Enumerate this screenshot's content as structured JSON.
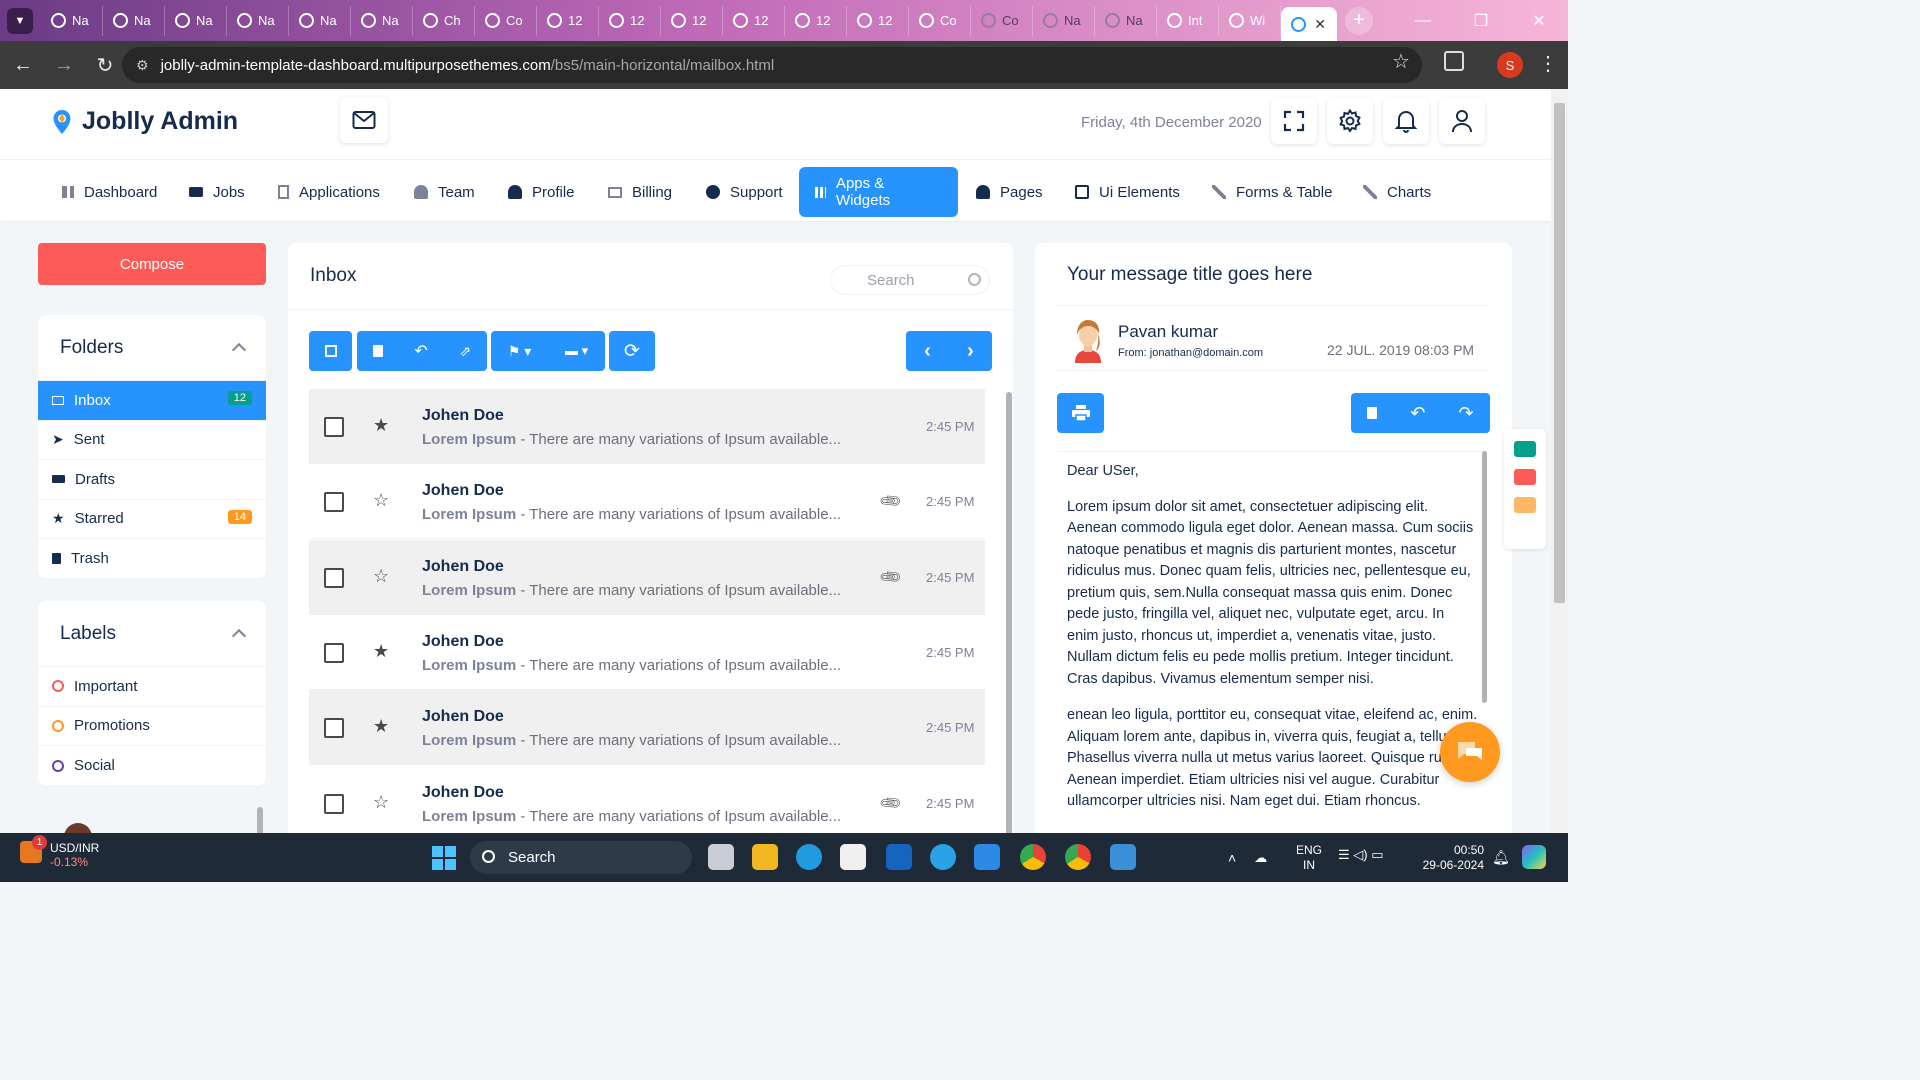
{
  "browser": {
    "tabs": [
      {
        "label": "Na"
      },
      {
        "label": "Na"
      },
      {
        "label": "Na"
      },
      {
        "label": "Na"
      },
      {
        "label": "Na"
      },
      {
        "label": "Na"
      },
      {
        "label": "Ch"
      },
      {
        "label": "Co"
      },
      {
        "label": "12"
      },
      {
        "label": "12"
      },
      {
        "label": "12"
      },
      {
        "label": "12"
      },
      {
        "label": "12"
      },
      {
        "label": "12"
      },
      {
        "label": "Co"
      },
      {
        "label": "Co"
      },
      {
        "label": "Na"
      },
      {
        "label": "Na"
      },
      {
        "label": "Int"
      },
      {
        "label": "Wi"
      }
    ],
    "url_site": "joblly-admin-template-dashboard.multipurposethemes.com",
    "url_path": "/bs5/main-horizontal/mailbox.html",
    "profile_initial": "S"
  },
  "header": {
    "logo_text": "Joblly Admin",
    "date": "Friday, 4th December 2020"
  },
  "nav": {
    "items": [
      {
        "label": "Dashboard"
      },
      {
        "label": "Jobs"
      },
      {
        "label": "Applications"
      },
      {
        "label": "Team"
      },
      {
        "label": "Profile"
      },
      {
        "label": "Billing"
      },
      {
        "label": "Support"
      },
      {
        "label": "Apps & Widgets"
      },
      {
        "label": "Pages"
      },
      {
        "label": "Ui Elements"
      },
      {
        "label": "Forms & Table"
      },
      {
        "label": "Charts"
      }
    ]
  },
  "sidebar": {
    "compose_label": "Compose",
    "folders_title": "Folders",
    "folders": [
      {
        "label": "Inbox",
        "badge": "12"
      },
      {
        "label": "Sent",
        "badge": ""
      },
      {
        "label": "Drafts",
        "badge": ""
      },
      {
        "label": "Starred",
        "badge": "14"
      },
      {
        "label": "Trash",
        "badge": ""
      }
    ],
    "labels_title": "Labels",
    "labels": [
      {
        "label": "Important",
        "color": "#fc5b58"
      },
      {
        "label": "Promotions",
        "color": "#ff9920"
      },
      {
        "label": "Social",
        "color": "#6b3fa0"
      }
    ]
  },
  "inbox": {
    "title": "Inbox",
    "search_placeholder": "Search",
    "mails": [
      {
        "sender": "Johen Doe",
        "subject": "Lorem Ipsum",
        "snippet": " - There are many variations of Ipsum available...",
        "time": "2:45 PM",
        "starred": true,
        "attachment": false
      },
      {
        "sender": "Johen Doe",
        "subject": "Lorem Ipsum",
        "snippet": " - There are many variations of Ipsum available...",
        "time": "2:45 PM",
        "starred": false,
        "attachment": true
      },
      {
        "sender": "Johen Doe",
        "subject": "Lorem Ipsum",
        "snippet": " - There are many variations of Ipsum available...",
        "time": "2:45 PM",
        "starred": false,
        "attachment": true
      },
      {
        "sender": "Johen Doe",
        "subject": "Lorem Ipsum",
        "snippet": " - There are many variations of Ipsum available...",
        "time": "2:45 PM",
        "starred": true,
        "attachment": false
      },
      {
        "sender": "Johen Doe",
        "subject": "Lorem Ipsum",
        "snippet": " - There are many variations of Ipsum available...",
        "time": "2:45 PM",
        "starred": true,
        "attachment": false
      },
      {
        "sender": "Johen Doe",
        "subject": "Lorem Ipsum",
        "snippet": " - There are many variations of Ipsum available...",
        "time": "2:45 PM",
        "starred": false,
        "attachment": true
      }
    ]
  },
  "reader": {
    "title": "Your message title goes here",
    "from_name": "Pavan kumar",
    "from_email": "From: jonathan@domain.com",
    "date": "22 JUL. 2019 08:03 PM",
    "greeting": "Dear USer,",
    "para1": "Lorem ipsum dolor sit amet, consectetuer adipiscing elit. Aenean commodo ligula eget dolor. Aenean massa. Cum sociis natoque penatibus et magnis dis parturient montes, nascetur ridiculus mus. Donec quam felis, ultricies nec, pellentesque eu, pretium quis, sem.Nulla consequat massa quis enim. Donec pede justo, fringilla vel, aliquet nec, vulputate eget, arcu. In enim justo, rhoncus ut, imperdiet a, venenatis vitae, justo. Nullam dictum felis eu pede mollis pretium. Integer tincidunt. Cras dapibus. Vivamus elementum semper nisi.",
    "para2": "enean leo ligula, porttitor eu, consequat vitae, eleifend ac, enim. Aliquam lorem ante, dapibus in, viverra quis, feugiat a, tellus. Phasellus viverra nulla ut metus varius laoreet. Quisque rutrum. Aenean imperdiet. Etiam ultricies nisi vel augue. Curabitur ullamcorper ultricies nisi. Nam eget dui. Etiam rhoncus."
  },
  "taskbar": {
    "stock_name": "USD/INR",
    "stock_change": "-0.13%",
    "stock_badge": "1",
    "search_label": "Search",
    "lang_line1": "ENG",
    "lang_line2": "IN",
    "time": "00:50",
    "date": "29-06-2024"
  },
  "colors": {
    "primary": "#2693ff",
    "compose": "#fc5b58",
    "badge_inbox": "#04a08b",
    "badge_starred": "#ff9920"
  }
}
